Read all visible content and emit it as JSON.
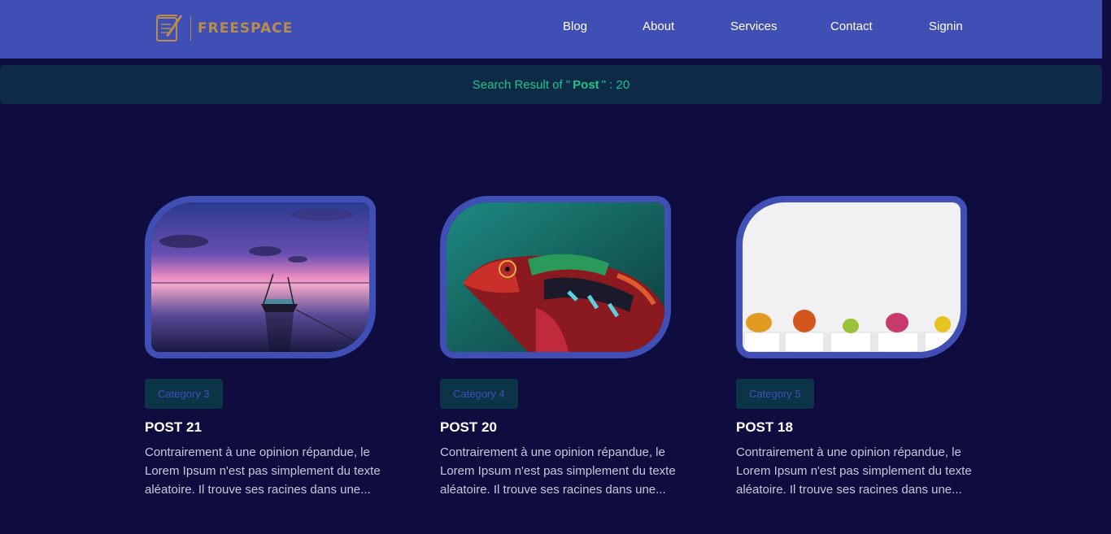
{
  "brand": {
    "name": "FREESPACE",
    "icon": "quill-document-icon",
    "color": "#b98d4a"
  },
  "nav": {
    "items": [
      {
        "label": "Blog"
      },
      {
        "label": "About"
      },
      {
        "label": "Services"
      },
      {
        "label": "Contact"
      },
      {
        "label": "Signin"
      }
    ]
  },
  "search": {
    "prefix": "Search Result of \"",
    "query": "Post",
    "suffix": "\" : 20"
  },
  "posts": [
    {
      "image": "sunset-boat-lake",
      "category": "Category 3",
      "title": "POST 21",
      "excerpt": "Contrairement à une opinion répandue, le Lorem Ipsum n'est pas simplement du texte aléatoire. Il trouve ses racines dans une..."
    },
    {
      "image": "chameleon",
      "category": "Category 4",
      "title": "POST 20",
      "excerpt": "Contrairement à une opinion répandue, le Lorem Ipsum n'est pas simplement du texte aléatoire. Il trouve ses racines dans une..."
    },
    {
      "image": "potted-cacti",
      "category": "Category 5",
      "title": "POST 18",
      "excerpt": "Contrairement à une opinion répandue, le Lorem Ipsum n'est pas simplement du texte aléatoire. Il trouve ses racines dans une..."
    }
  ],
  "colors": {
    "navbar": "#3f4fb5",
    "background": "#0f0d3f",
    "banner": "#0d2a47",
    "banner_text": "#1ec58a",
    "badge_bg": "#0b3447",
    "badge_text": "#3552b8"
  }
}
